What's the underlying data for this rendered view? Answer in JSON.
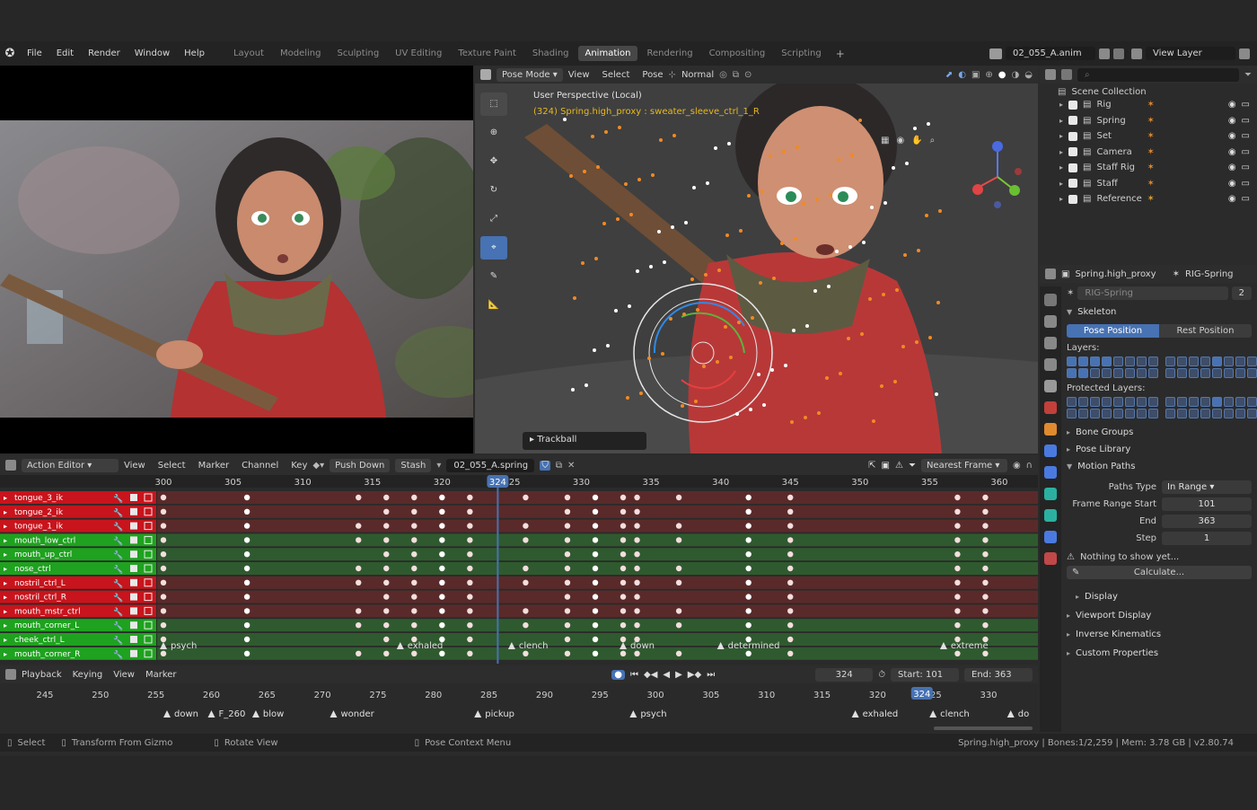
{
  "menu": [
    "File",
    "Edit",
    "Render",
    "Window",
    "Help"
  ],
  "workspaces": [
    {
      "label": "Layout",
      "active": false
    },
    {
      "label": "Modeling",
      "active": false
    },
    {
      "label": "Sculpting",
      "active": false
    },
    {
      "label": "UV Editing",
      "active": false
    },
    {
      "label": "Texture Paint",
      "active": false
    },
    {
      "label": "Shading",
      "active": false
    },
    {
      "label": "Animation",
      "active": true
    },
    {
      "label": "Rendering",
      "active": false
    },
    {
      "label": "Compositing",
      "active": false
    },
    {
      "label": "Scripting",
      "active": false
    }
  ],
  "add_workspace": "+",
  "scene_name": "02_055_A.anim",
  "view_layer": "View Layer",
  "viewport": {
    "mode": "Pose Mode",
    "menus": [
      "View",
      "Select",
      "Pose"
    ],
    "orientation": "Normal",
    "perspective": "User Perspective (Local)",
    "active": "(324) Spring.high_proxy : sweater_sleeve_ctrl_1_R",
    "trackball": "Trackball",
    "gizmo_axes": [
      "Z",
      "X",
      "Y"
    ]
  },
  "outliner": {
    "title": "Scene Collection",
    "items": [
      {
        "label": "Rig"
      },
      {
        "label": "Spring"
      },
      {
        "label": "Set"
      },
      {
        "label": "Camera"
      },
      {
        "label": "Staff Rig"
      },
      {
        "label": "Staff"
      },
      {
        "label": "Reference"
      }
    ]
  },
  "properties": {
    "object": "Spring.high_proxy",
    "armature": "RIG-Spring",
    "data_name": "RIG-Spring",
    "users": "2",
    "skeleton": "Skeleton",
    "pose_position": "Pose Position",
    "rest_position": "Rest Position",
    "layers": "Layers:",
    "protected_layers": "Protected Layers:",
    "bone_groups": "Bone Groups",
    "pose_library": "Pose Library",
    "motion_paths": "Motion Paths",
    "paths_type_label": "Paths Type",
    "paths_type": "In Range",
    "frame_range_start_label": "Frame Range Start",
    "frame_range_start": "101",
    "end_label": "End",
    "end": "363",
    "step_label": "Step",
    "step": "1",
    "nothing": "Nothing to show yet...",
    "calculate": "Calculate...",
    "display": "Display",
    "viewport_display": "Viewport Display",
    "inverse_kinematics": "Inverse Kinematics",
    "custom_properties": "Custom Properties"
  },
  "action_editor": {
    "mode": "Action Editor",
    "menus": [
      "View",
      "Select",
      "Marker",
      "Channel",
      "Key"
    ],
    "push_down": "Push Down",
    "stash": "Stash",
    "action": "02_055_A.spring",
    "snap": "Nearest Frame",
    "current_frame": "324",
    "ruler": [
      "300",
      "305",
      "310",
      "315",
      "320",
      "325",
      "330",
      "335",
      "340",
      "345",
      "350",
      "355",
      "360"
    ],
    "channels": [
      {
        "label": "tongue_3_ik",
        "color": "#c8141c"
      },
      {
        "label": "tongue_2_ik",
        "color": "#c8141c"
      },
      {
        "label": "tongue_1_ik",
        "color": "#c8141c"
      },
      {
        "label": "mouth_low_ctrl",
        "color": "#1fa21f"
      },
      {
        "label": "mouth_up_ctrl",
        "color": "#1fa21f"
      },
      {
        "label": "nose_ctrl",
        "color": "#1fa21f"
      },
      {
        "label": "nostril_ctrl_L",
        "color": "#c8141c"
      },
      {
        "label": "nostril_ctrl_R",
        "color": "#c8141c"
      },
      {
        "label": "mouth_mstr_ctrl",
        "color": "#c8141c"
      },
      {
        "label": "mouth_corner_L",
        "color": "#1fa21f"
      },
      {
        "label": "cheek_ctrl_L",
        "color": "#1fa21f"
      },
      {
        "label": "mouth_corner_R",
        "color": "#1fa21f"
      }
    ],
    "markers": [
      {
        "label": "psych",
        "frame": 300
      },
      {
        "label": "exhaled",
        "frame": 317
      },
      {
        "label": "clench",
        "frame": 325
      },
      {
        "label": "down",
        "frame": 333
      },
      {
        "label": "determined",
        "frame": 340
      },
      {
        "label": "extreme",
        "frame": 356
      }
    ],
    "key_frames": [
      300,
      306,
      314,
      316,
      318,
      320,
      322,
      326,
      329,
      331,
      333,
      334,
      337,
      342,
      345,
      357,
      359,
      363
    ]
  },
  "timeline": {
    "menus": [
      "Playback",
      "Keying",
      "View",
      "Marker"
    ],
    "current": "324",
    "start_label": "Start:",
    "start": "101",
    "end_label": "End:",
    "end": "363",
    "ruler": [
      "245",
      "250",
      "255",
      "260",
      "265",
      "270",
      "275",
      "280",
      "285",
      "290",
      "295",
      "300",
      "305",
      "310",
      "315",
      "320",
      "325",
      "330"
    ],
    "markers": [
      {
        "label": "down",
        "frame": 256
      },
      {
        "label": "F_260",
        "frame": 260
      },
      {
        "label": "blow",
        "frame": 264
      },
      {
        "label": "wonder",
        "frame": 271
      },
      {
        "label": "pickup",
        "frame": 284
      },
      {
        "label": "psych",
        "frame": 298
      },
      {
        "label": "exhaled",
        "frame": 318
      },
      {
        "label": "clench",
        "frame": 325
      },
      {
        "label": "do",
        "frame": 332
      }
    ]
  },
  "status": {
    "select": "Select",
    "transform": "Transform From Gizmo",
    "rotate": "Rotate View",
    "context": "Pose Context Menu",
    "info": "Spring.high_proxy | Bones:1/2,259 | Mem: 3.78 GB | v2.80.74"
  },
  "colors": {
    "accent": "#4772b3",
    "active_tab": "#474747",
    "marker": "#e0e0e0",
    "key_white": "#f0e6e6"
  }
}
